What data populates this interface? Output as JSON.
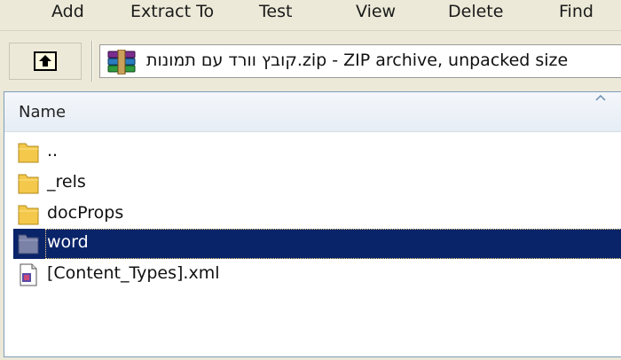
{
  "toolbar": {
    "items": [
      {
        "label": "Add",
        "icon": "add-icon"
      },
      {
        "label": "Extract To",
        "icon": "extract-icon"
      },
      {
        "label": "Test",
        "icon": "test-icon"
      },
      {
        "label": "View",
        "icon": "view-icon"
      },
      {
        "label": "Delete",
        "icon": "delete-icon"
      },
      {
        "label": "Find",
        "icon": "find-icon"
      }
    ]
  },
  "address": {
    "path_text": "קובץ וורד עם תמונות.zip - ZIP archive, unpacked size",
    "icon": "winrar-archive-icon",
    "up_icon": "up-folder-icon"
  },
  "file_list": {
    "column_name": "Name",
    "rows": [
      {
        "name": "..",
        "type": "folder"
      },
      {
        "name": "_rels",
        "type": "folder"
      },
      {
        "name": "docProps",
        "type": "folder"
      },
      {
        "name": "word",
        "type": "folder",
        "selected": true
      },
      {
        "name": "[Content_Types].xml",
        "type": "xml"
      }
    ]
  },
  "colors": {
    "selection": "#0a246a",
    "folder": "#f4c84a",
    "chrome": "#ece9d8"
  }
}
